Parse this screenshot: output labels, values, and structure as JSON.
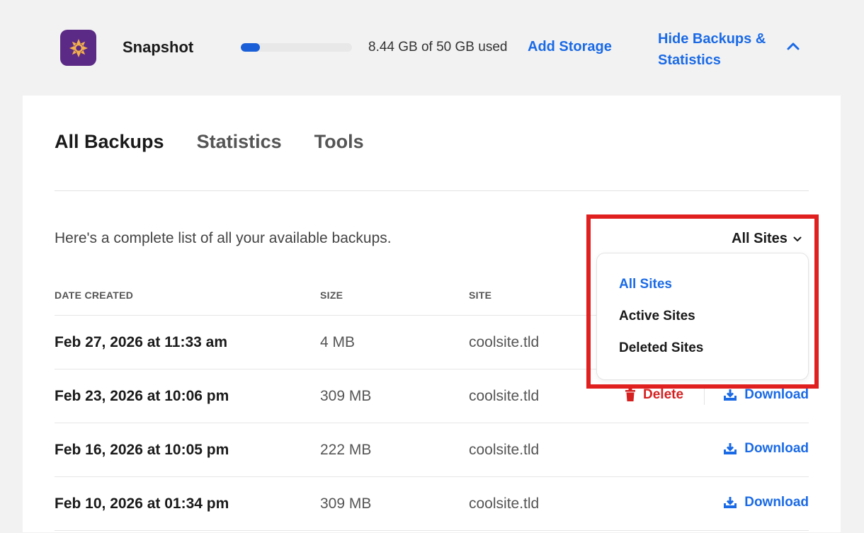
{
  "header": {
    "app_icon": "snapshot-logo",
    "app_name": "Snapshot",
    "storage_used_fraction": 0.169,
    "storage_text": "8.44 GB of 50 GB used",
    "add_storage_label": "Add Storage",
    "hide_label": "Hide Backups & Statistics"
  },
  "tabs": [
    {
      "label": "All Backups",
      "active": true
    },
    {
      "label": "Statistics",
      "active": false
    },
    {
      "label": "Tools",
      "active": false
    }
  ],
  "intro_text": "Here's a complete list of all your available backups.",
  "filter": {
    "selected": "All Sites",
    "options": [
      "All Sites",
      "Active Sites",
      "Deleted Sites"
    ]
  },
  "columns": {
    "date": "DATE CREATED",
    "size": "SIZE",
    "site": "SITE"
  },
  "rows": [
    {
      "date": "Feb 27, 2026 at 11:33 am",
      "size": "4 MB",
      "site": "coolsite.tld",
      "delete": "",
      "download": ""
    },
    {
      "date": "Feb 23, 2026 at 10:06 pm",
      "size": "309 MB",
      "site": "coolsite.tld",
      "delete": "Delete",
      "download": "Download"
    },
    {
      "date": "Feb 16, 2026 at 10:05 pm",
      "size": "222 MB",
      "site": "coolsite.tld",
      "delete": "",
      "download": "Download"
    },
    {
      "date": "Feb 10, 2026 at 01:34 pm",
      "size": "309 MB",
      "site": "coolsite.tld",
      "delete": "",
      "download": "Download"
    }
  ],
  "colors": {
    "accent": "#1a6ae6",
    "danger": "#d62020",
    "brand": "#5b2a86",
    "highlight": "#e01f1f"
  }
}
